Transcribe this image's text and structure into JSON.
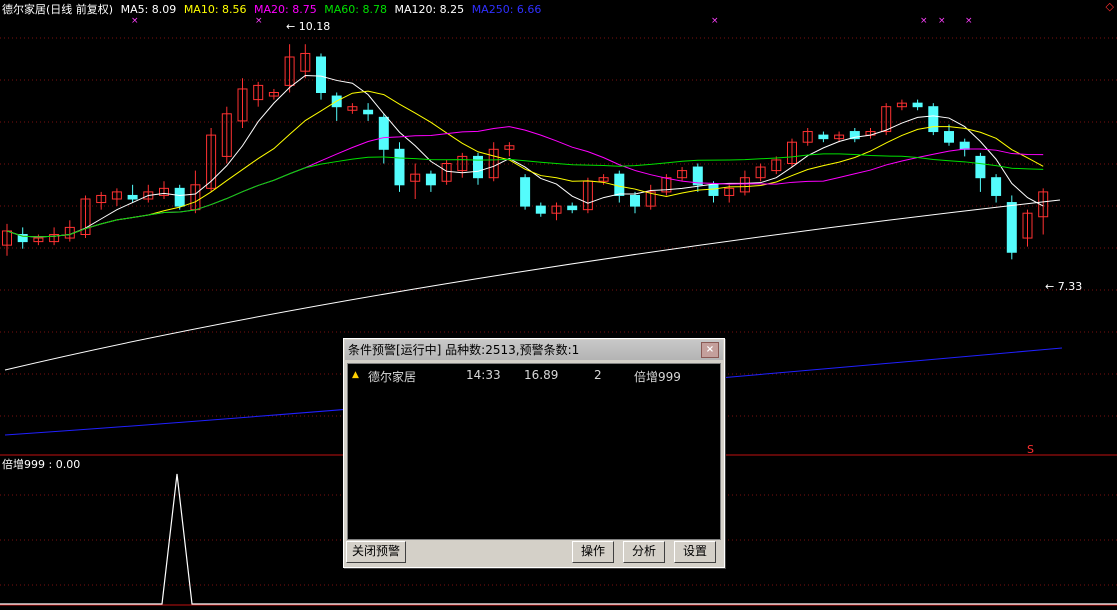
{
  "header": {
    "title": "德尔家居(日线 前复权)",
    "ma5": "MA5: 8.09",
    "ma10": "MA10: 8.56",
    "ma20": "MA20: 8.75",
    "ma60": "MA60: 8.78",
    "ma120": "MA120: 8.25",
    "ma250": "MA250: 6.66"
  },
  "corner_symbol": "◇",
  "price_high_label": "10.18",
  "price_low_label": "7.33",
  "signal_marker": "S",
  "sub_indicator": "倍增999 : 0.00",
  "colors": {
    "up": "#ff3232",
    "down": "#54fcfc",
    "ma5": "#ffffff",
    "ma10": "#ffff00",
    "ma20": "#ff00ff",
    "ma60": "#00e000",
    "ma120": "#ffffff",
    "ma250": "#2020ff"
  },
  "dialog": {
    "title": "条件预警[运行中] 品种数:2513,预警条数:1",
    "close_glyph": "×",
    "rows": [
      {
        "arrow": "▲",
        "name": "德尔家居",
        "time": "14:33",
        "price": "16.89",
        "count": "2",
        "condition": "倍增999"
      }
    ],
    "buttons": {
      "close_alert": "关闭预警",
      "operate": "操作",
      "analyze": "分析",
      "settings": "设置"
    }
  }
}
